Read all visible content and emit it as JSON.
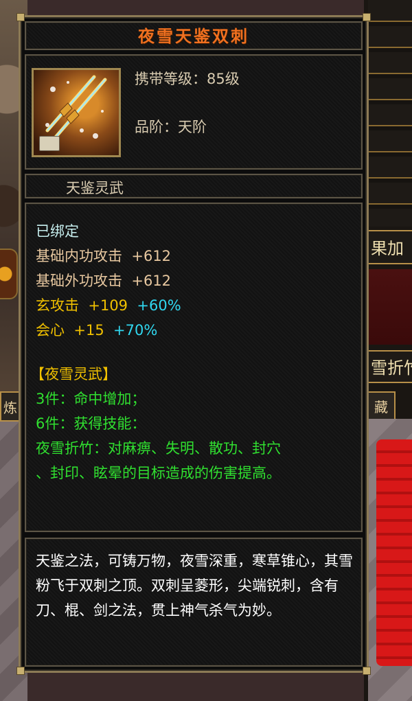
{
  "background": {
    "left_tab": "炼",
    "right_panel_text": "果加",
    "right_panel2_text": "雪折竹",
    "right_tab": "藏"
  },
  "item": {
    "name": "夜雪天鉴双刺",
    "icon": "twin-dagger-weapon-icon",
    "level_req": "携带等级：85级",
    "grade": "品阶：天阶",
    "set_name": "天鉴灵武"
  },
  "stats": {
    "bound": "已绑定",
    "inner_atk_label": "基础内功攻击",
    "inner_atk_value": "+612",
    "outer_atk_label": "基础外功攻击",
    "outer_atk_value": "+612",
    "xuan_label": "玄攻击",
    "xuan_value": "+109",
    "xuan_bonus": "+60%",
    "crit_label": "会心",
    "crit_value": "+15",
    "crit_bonus": "+70%"
  },
  "set_bonus": {
    "title": "【夜雪灵武】",
    "piece3": "3件：命中增加；",
    "piece6": "6件：获得技能：",
    "skill_line1": "夜雪折竹：对麻痹、失明、散功、封穴",
    "skill_line2": "、封印、眩晕的目标造成的伤害提高。"
  },
  "description": "天鉴之法，可铸万物，夜雪深重，寒草锥心，其雪粉飞于双刺之顶。双刺呈菱形，尖端锐刺，含有刀、棍、剑之法，贯上神气杀气为妙。",
  "colors": {
    "title": "#f07020",
    "bound": "#c8f0f0",
    "base_stat": "#e8c8a0",
    "elemental_stat": "#f0c000",
    "bonus_percent": "#30d8f0",
    "set_bonus": "#30e030",
    "description": "#ffffff"
  }
}
